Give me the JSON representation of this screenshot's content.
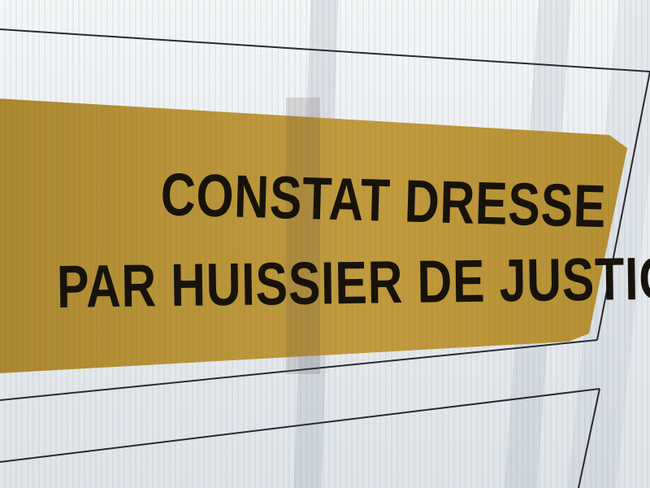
{
  "sign": {
    "line1": "CONSTAT DRESSE",
    "line2": "PAR HUISSIER DE JUSTICE"
  },
  "colors": {
    "plate": "#b8943a",
    "text": "#17130b",
    "panel": "#e9ecee",
    "frame_line": "#2a2a33"
  }
}
